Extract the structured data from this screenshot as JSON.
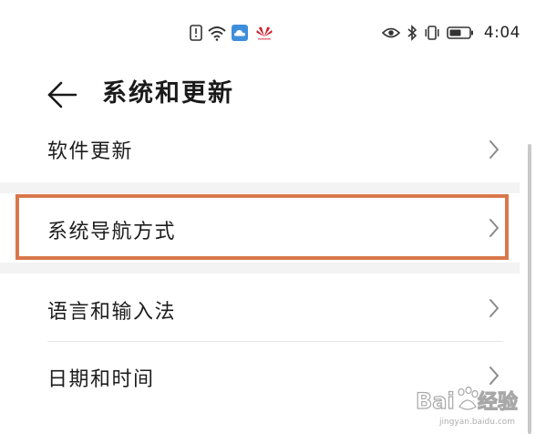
{
  "status_bar": {
    "time": "4:04",
    "left_icons": [
      "alert-icon",
      "wifi-icon",
      "cloud-icon",
      "huawei-logo-icon"
    ],
    "right_icons": [
      "eye-icon",
      "bluetooth-icon",
      "vibrate-icon",
      "battery-icon"
    ]
  },
  "header": {
    "back_icon": "arrow-left-icon",
    "title": "系统和更新"
  },
  "settings": {
    "items": [
      {
        "label": "软件更新"
      },
      {
        "label": "系统导航方式"
      },
      {
        "label": "语言和输入法"
      },
      {
        "label": "日期和时间"
      }
    ]
  },
  "highlight_color": "#d9784c",
  "watermark": {
    "label": "Baidu 经验",
    "url": "jingyan.baidu.com"
  }
}
